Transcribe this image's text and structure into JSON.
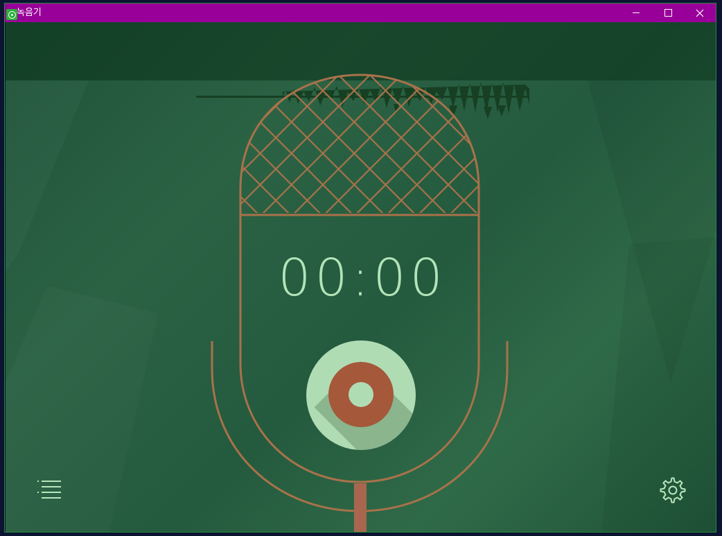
{
  "window": {
    "title": "녹음기",
    "app_icon": "recorder-app-icon",
    "titlebar_color": "#990099",
    "controls": {
      "minimize_icon": "minimize-icon",
      "maximize_icon": "maximize-icon",
      "close_icon": "close-icon"
    }
  },
  "recorder": {
    "timer": {
      "d1": "0",
      "d2": "0",
      "sep": ":",
      "d3": "0",
      "d4": "0"
    },
    "record_icon": "record-icon",
    "recordings_list_icon": "list-icon",
    "settings_icon": "gear-icon",
    "accent_color": "#a5583a",
    "timer_color": "#b2e4b8"
  }
}
